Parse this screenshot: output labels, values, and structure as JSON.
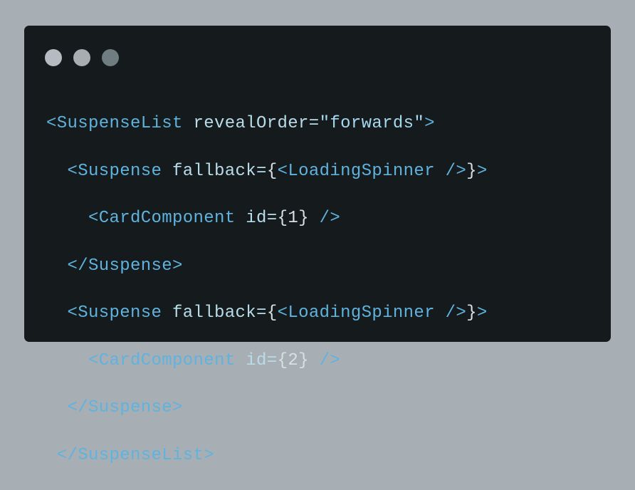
{
  "colors": {
    "background": "#a7aeb4",
    "editor_background": "#151a1c",
    "dot_1": "#b4bcc1",
    "dot_2": "#a6aeb2",
    "dot_3": "#6f7d81",
    "tag": "#5fb3de",
    "attribute": "#b9dcea",
    "string": "#a6d8ee",
    "punctuation": "#d7e0e4"
  },
  "window_controls": [
    {
      "name": "window-dot-1",
      "color": "#b4bcc1"
    },
    {
      "name": "window-dot-2",
      "color": "#a6aeb2"
    },
    {
      "name": "window-dot-3",
      "color": "#6f7d81"
    }
  ],
  "code": {
    "lines": [
      {
        "tokens": [
          {
            "text": "<SuspenseList",
            "kind": "tag"
          },
          {
            "text": " revealOrder=",
            "kind": "attr"
          },
          {
            "text": "\"forwards\"",
            "kind": "str"
          },
          {
            "text": ">",
            "kind": "tag"
          }
        ]
      },
      {
        "tokens": [
          {
            "text": "  <Suspense",
            "kind": "tag"
          },
          {
            "text": " fallback=",
            "kind": "attr"
          },
          {
            "text": "{",
            "kind": "punc"
          },
          {
            "text": "<LoadingSpinner />",
            "kind": "tag"
          },
          {
            "text": "}",
            "kind": "punc"
          },
          {
            "text": ">",
            "kind": "tag"
          }
        ]
      },
      {
        "tokens": [
          {
            "text": "    <CardComponent",
            "kind": "tag"
          },
          {
            "text": " id=",
            "kind": "attr"
          },
          {
            "text": "{1}",
            "kind": "punc"
          },
          {
            "text": " />",
            "kind": "tag"
          }
        ]
      },
      {
        "tokens": [
          {
            "text": "  </Suspense>",
            "kind": "tag"
          }
        ]
      },
      {
        "tokens": [
          {
            "text": "  <Suspense",
            "kind": "tag"
          },
          {
            "text": " fallback=",
            "kind": "attr"
          },
          {
            "text": "{",
            "kind": "punc"
          },
          {
            "text": "<LoadingSpinner />",
            "kind": "tag"
          },
          {
            "text": "}",
            "kind": "punc"
          },
          {
            "text": ">",
            "kind": "tag"
          }
        ]
      },
      {
        "tokens": [
          {
            "text": "    <CardComponent",
            "kind": "tag"
          },
          {
            "text": " id=",
            "kind": "attr"
          },
          {
            "text": "{2}",
            "kind": "punc"
          },
          {
            "text": " />",
            "kind": "tag"
          }
        ]
      },
      {
        "tokens": [
          {
            "text": "  </Suspense>",
            "kind": "tag"
          }
        ]
      },
      {
        "tokens": [
          {
            "text": " </SuspenseList>",
            "kind": "tag"
          }
        ]
      }
    ]
  }
}
